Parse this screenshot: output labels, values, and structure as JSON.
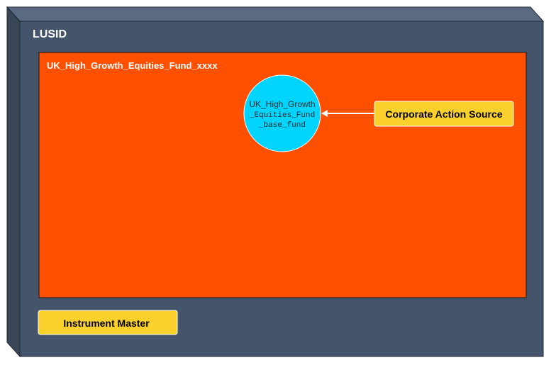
{
  "container": {
    "title": "LUSID",
    "fill": "#44546a",
    "side_fill": "#384657",
    "border": "#1f2a36"
  },
  "fund": {
    "title": "UK_High_Growth_Equities_Fund_xxxx",
    "fill": "#ff5000",
    "border": "#1a1a1a"
  },
  "portfolio": {
    "lines": [
      "UK_High_Growth",
      "_Equities_Fund",
      "_base_fund"
    ],
    "fill": "#00d4ff",
    "text_color": "#2b2b2b"
  },
  "corporate_action_source": {
    "label": "Corporate Action Source",
    "fill": "#fad02c"
  },
  "instrument_master": {
    "label": "Instrument Master",
    "fill": "#fad02c"
  },
  "connector": {
    "color": "#ffffff"
  }
}
